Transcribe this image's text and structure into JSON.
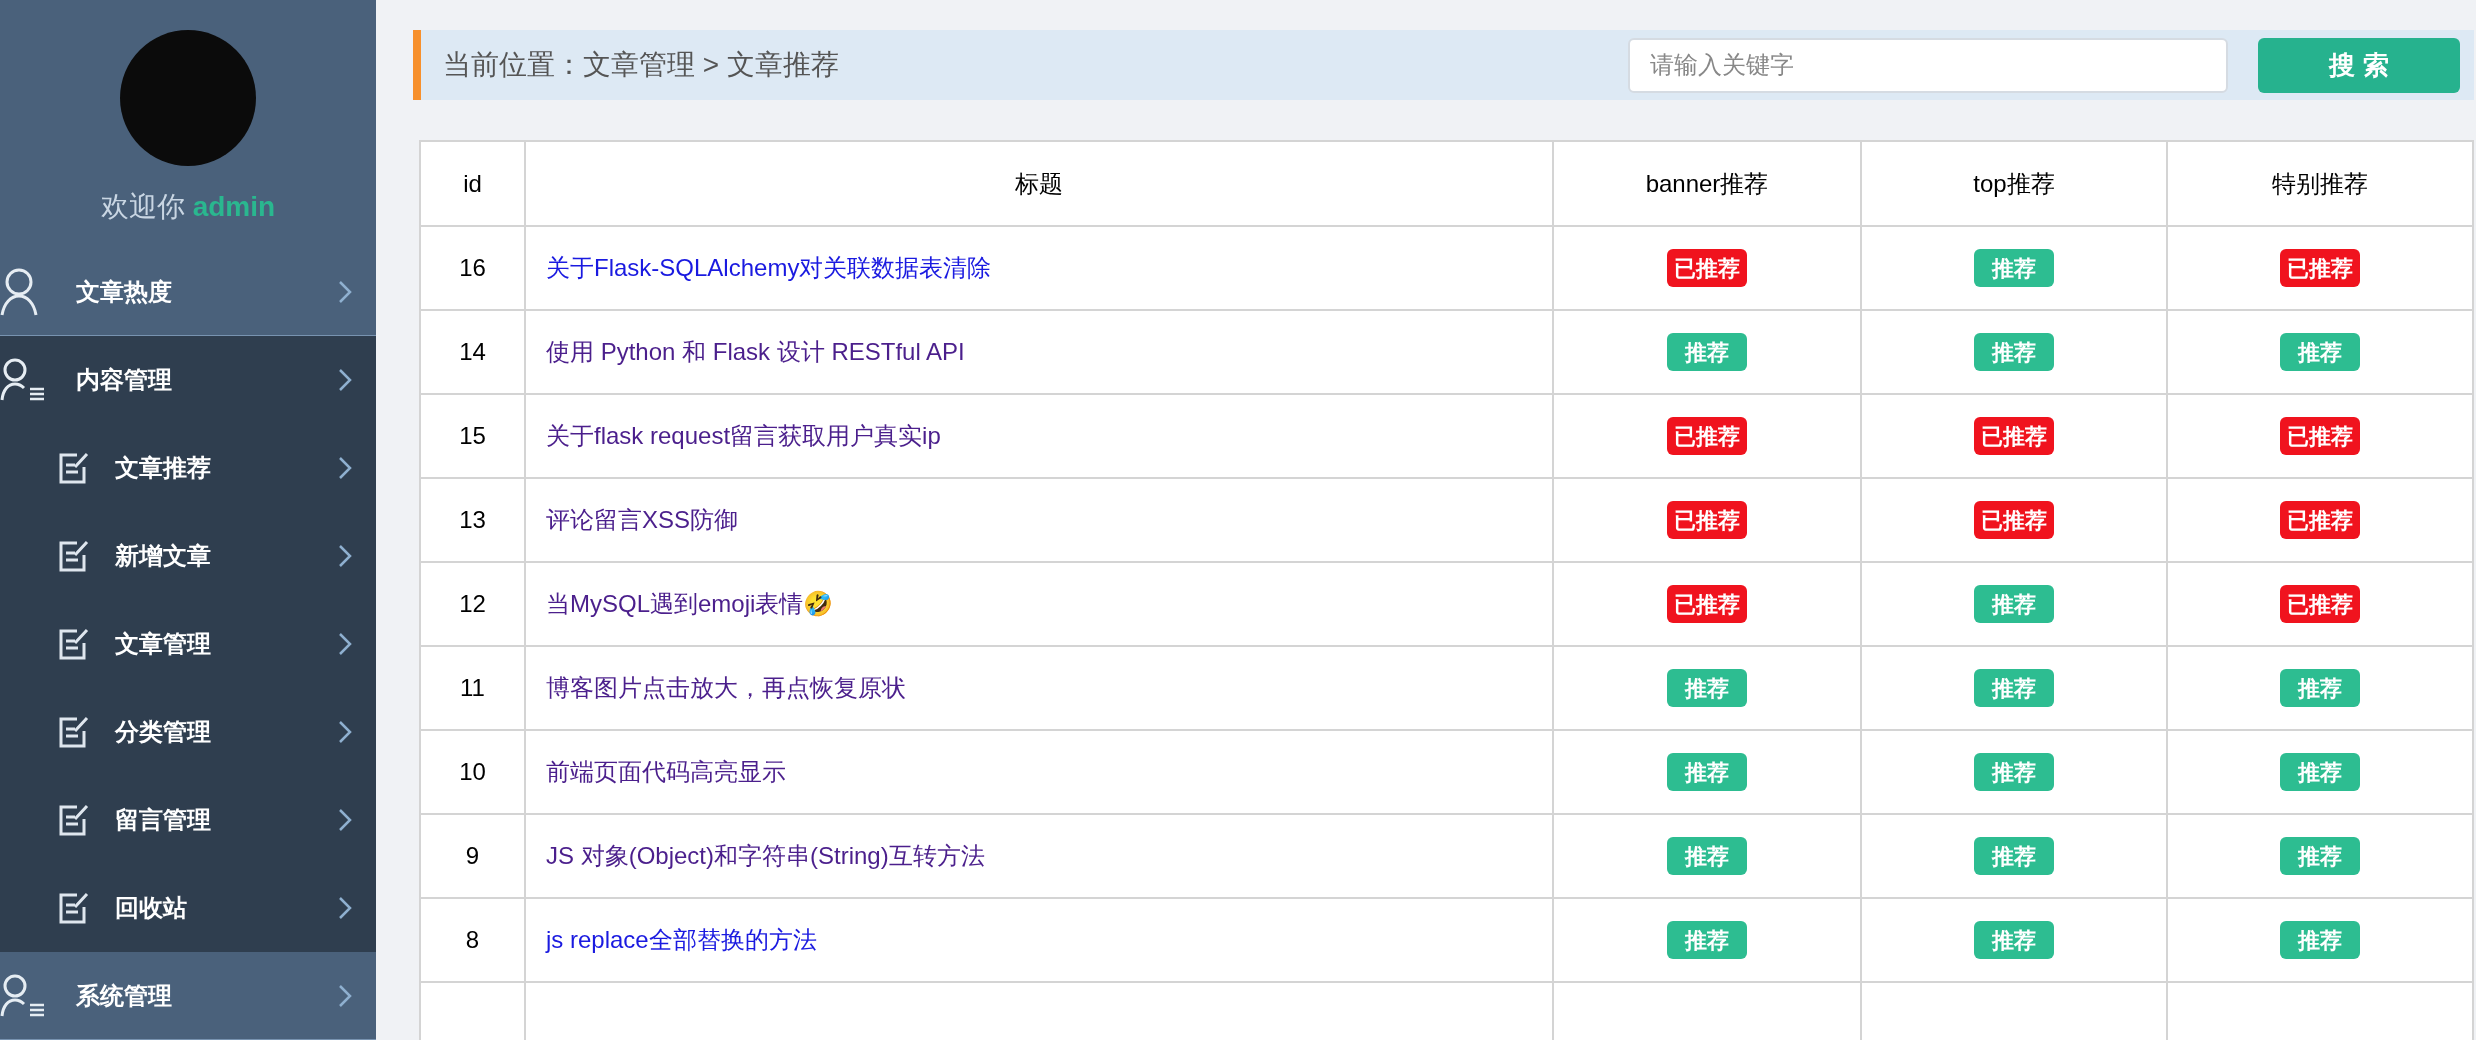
{
  "sidebar": {
    "welcome": "欢迎你",
    "username": "admin",
    "menu": [
      {
        "label": "文章热度",
        "kind": "user",
        "expanded": false
      },
      {
        "label": "内容管理",
        "kind": "user-list",
        "expanded": true,
        "children": [
          {
            "label": "文章推荐"
          },
          {
            "label": "新增文章"
          },
          {
            "label": "文章管理"
          },
          {
            "label": "分类管理"
          },
          {
            "label": "留言管理"
          },
          {
            "label": "回收站"
          }
        ]
      },
      {
        "label": "系统管理",
        "kind": "user-list",
        "expanded": false
      }
    ]
  },
  "breadcrumb": "当前位置：文章管理 > 文章推荐",
  "search": {
    "placeholder": "请输入关键字",
    "button": "搜 索"
  },
  "table": {
    "columns": [
      "id",
      "标题",
      "banner推荐",
      "top推荐",
      "特别推荐"
    ],
    "rows": [
      {
        "id": "16",
        "title": "关于Flask-SQLAlchemy对关联数据表清除",
        "visited": false,
        "flags": [
          {
            "label": "已推荐",
            "recommended": true
          },
          {
            "label": "推荐",
            "recommended": false
          },
          {
            "label": "已推荐",
            "recommended": true
          }
        ]
      },
      {
        "id": "14",
        "title": "使用 Python 和 Flask 设计 RESTful API",
        "visited": true,
        "flags": [
          {
            "label": "推荐",
            "recommended": false
          },
          {
            "label": "推荐",
            "recommended": false
          },
          {
            "label": "推荐",
            "recommended": false
          }
        ]
      },
      {
        "id": "15",
        "title": "关于flask request留言获取用户真实ip",
        "visited": true,
        "flags": [
          {
            "label": "已推荐",
            "recommended": true
          },
          {
            "label": "已推荐",
            "recommended": true
          },
          {
            "label": "已推荐",
            "recommended": true
          }
        ]
      },
      {
        "id": "13",
        "title": "评论留言XSS防御",
        "visited": true,
        "flags": [
          {
            "label": "已推荐",
            "recommended": true
          },
          {
            "label": "已推荐",
            "recommended": true
          },
          {
            "label": "已推荐",
            "recommended": true
          }
        ]
      },
      {
        "id": "12",
        "title": "当MySQL遇到emoji表情🤣",
        "visited": true,
        "flags": [
          {
            "label": "已推荐",
            "recommended": true
          },
          {
            "label": "推荐",
            "recommended": false
          },
          {
            "label": "已推荐",
            "recommended": true
          }
        ]
      },
      {
        "id": "11",
        "title": "博客图片点击放大，再点恢复原状",
        "visited": true,
        "flags": [
          {
            "label": "推荐",
            "recommended": false
          },
          {
            "label": "推荐",
            "recommended": false
          },
          {
            "label": "推荐",
            "recommended": false
          }
        ]
      },
      {
        "id": "10",
        "title": "前端页面代码高亮显示",
        "visited": true,
        "flags": [
          {
            "label": "推荐",
            "recommended": false
          },
          {
            "label": "推荐",
            "recommended": false
          },
          {
            "label": "推荐",
            "recommended": false
          }
        ]
      },
      {
        "id": "9",
        "title": "JS 对象(Object)和字符串(String)互转方法",
        "visited": true,
        "flags": [
          {
            "label": "推荐",
            "recommended": false
          },
          {
            "label": "推荐",
            "recommended": false
          },
          {
            "label": "推荐",
            "recommended": false
          }
        ]
      },
      {
        "id": "8",
        "title": "js replace全部替换的方法",
        "visited": false,
        "flags": [
          {
            "label": "推荐",
            "recommended": false
          },
          {
            "label": "推荐",
            "recommended": false
          },
          {
            "label": "推荐",
            "recommended": false
          }
        ]
      }
    ]
  }
}
